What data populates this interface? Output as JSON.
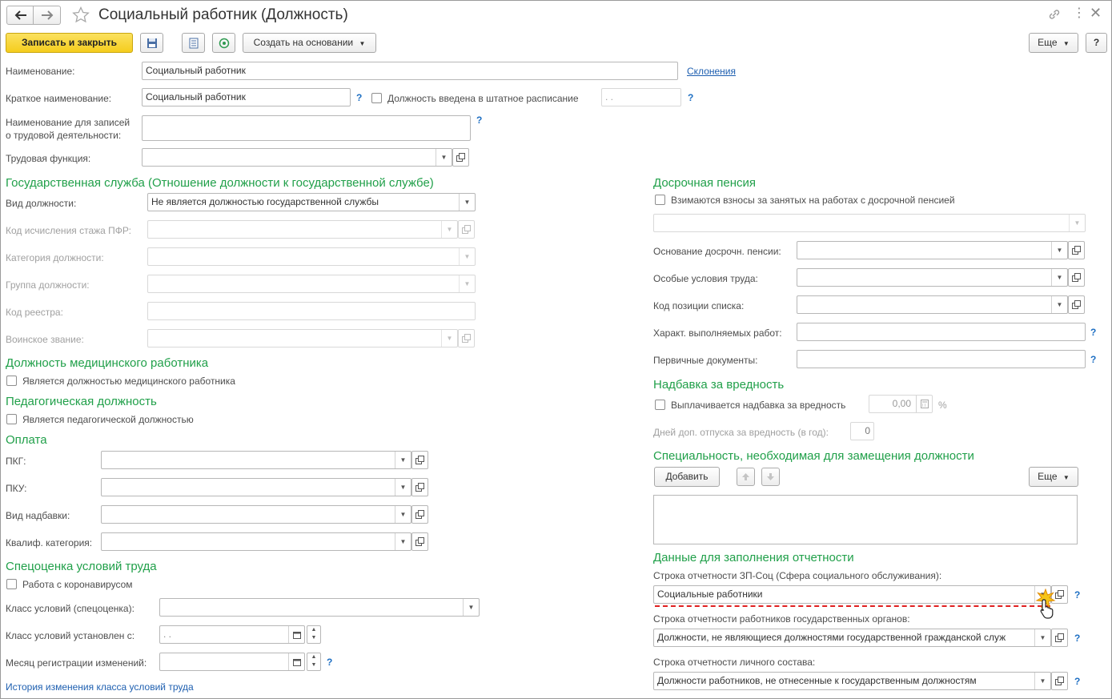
{
  "window": {
    "title": "Социальный работник (Должность)"
  },
  "toolbar": {
    "save_close": "Записать и закрыть",
    "create_basis": "Создать на основании",
    "more": "Еще",
    "help": "?"
  },
  "form": {
    "name_label": "Наименование:",
    "name_value": "Социальный работник",
    "declension_link": "Склонения",
    "short_label": "Краткое наименование:",
    "short_value": "Социальный работник",
    "staff_checkbox_label": "Должность введена в штатное расписание",
    "staff_date": " .  .",
    "labor_records_label_1": "Наименование для записей",
    "labor_records_label_2": "о трудовой деятельности:",
    "labor_function_label": "Трудовая функция:"
  },
  "gov_service": {
    "title": "Государственная служба (Отношение должности к государственной службе)",
    "kind_label": "Вид должности:",
    "kind_value": "Не является должностью государственной службы",
    "pfr_label": "Код исчисления стажа ПФР:",
    "category_label": "Категория должности:",
    "group_label": "Группа должности:",
    "registry_label": "Код реестра:",
    "rank_label": "Воинское звание:"
  },
  "medical": {
    "title": "Должность медицинского работника",
    "checkbox": "Является должностью медицинского работника"
  },
  "pedagogical": {
    "title": "Педагогическая должность",
    "checkbox": "Является педагогической должностью"
  },
  "payment": {
    "title": "Оплата",
    "pkg_label": "ПКГ:",
    "pku_label": "ПКУ:",
    "bonus_label": "Вид надбавки:",
    "qual_label": "Квалиф. категория:"
  },
  "spec_eval": {
    "title": "Спецоценка условий труда",
    "covid_checkbox": "Работа с коронавирусом",
    "class_label": "Класс условий (спецоценка):",
    "class_set_label": "Класс условий установлен с:",
    "class_set_value": " .  .",
    "month_label": "Месяц регистрации изменений:",
    "history_link": "История изменения класса условий труда"
  },
  "early_pension": {
    "title": "Досрочная пенсия",
    "checkbox": "Взимаются взносы за занятых на работах с досрочной пенсией",
    "basis_label": "Основание досрочн. пенсии:",
    "special_label": "Особые условия труда:",
    "position_label": "Код позиции списка:",
    "work_char_label": "Характ. выполняемых работ:",
    "primary_docs_label": "Первичные документы:"
  },
  "hazard": {
    "title": "Надбавка за вредность",
    "checkbox": "Выплачивается надбавка за вредность",
    "value": "0,00",
    "percent": "%",
    "days_label": "Дней доп. отпуска за вредность (в год):",
    "days_value": "0"
  },
  "specialty": {
    "title": "Специальность, необходимая для замещения должности",
    "add_button": "Добавить",
    "more_button": "Еще"
  },
  "reporting": {
    "title": "Данные для заполнения отчетности",
    "zp_label": "Строка отчетности ЗП-Соц (Сфера социального обслуживания):",
    "zp_value": "Социальные работники",
    "gov_label": "Строка отчетности работников государственных органов:",
    "gov_value": "Должности, не являющиеся должностями государственной гражданской служ",
    "personnel_label": "Строка отчетности личного состава:",
    "personnel_value": "Должности работников, не отнесенные к государственным должностям"
  },
  "colors": {
    "section": "#21a04a",
    "link": "#1e5fb0",
    "primary": "#f5cd1d",
    "highlight": "#e02020"
  }
}
